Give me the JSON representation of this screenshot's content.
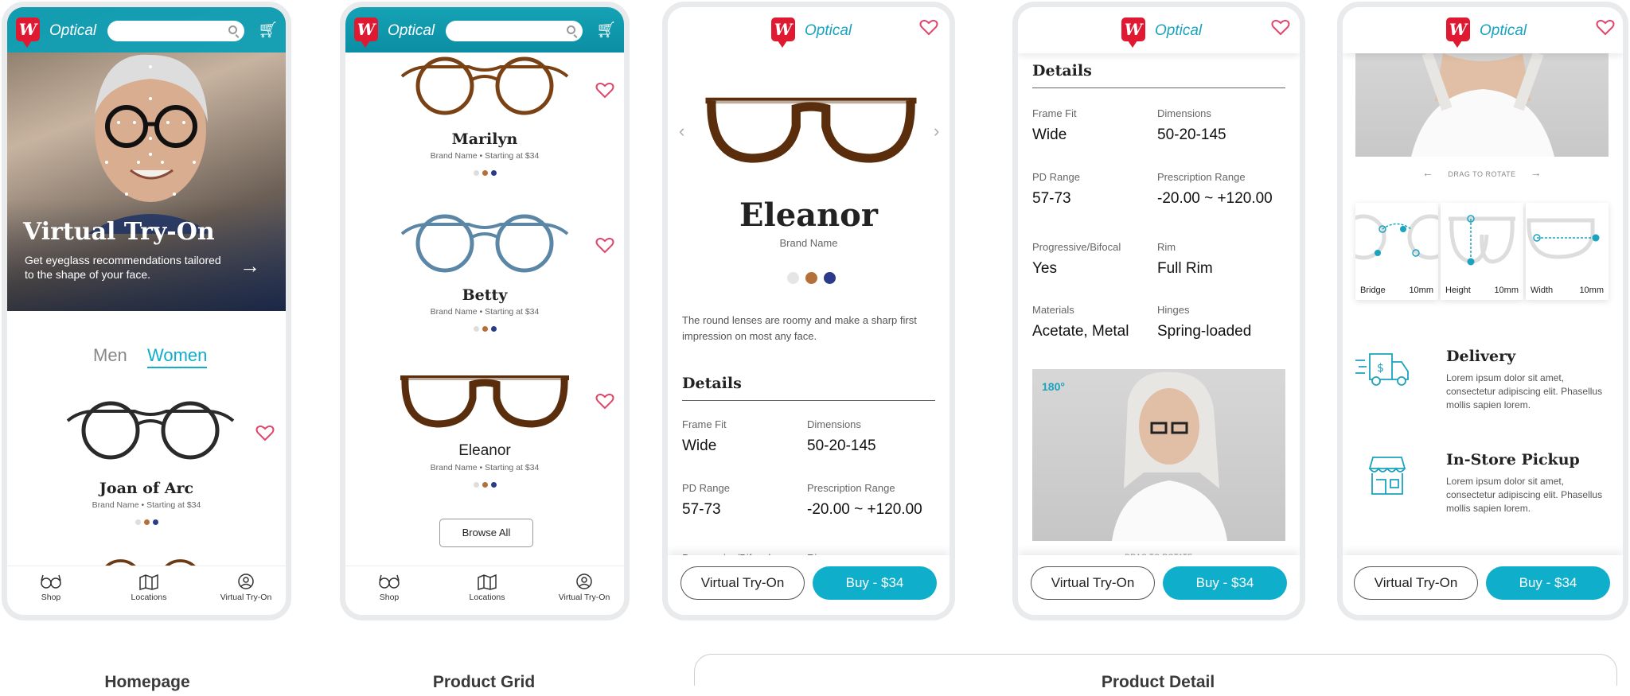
{
  "colors": {
    "teal": "#0e9fb4",
    "accent": "#0faecb",
    "brand_red": "#e01933",
    "heart": "#e0456a"
  },
  "brand": {
    "logo_letter": "W",
    "app_name": "Optical"
  },
  "nav": {
    "shop": "Shop",
    "locations": "Locations",
    "vto": "Virtual Try-On"
  },
  "homepage": {
    "hero_title": "Virtual Try-On",
    "hero_text": "Get eyeglass recommendations tailored to the shape of your face.",
    "tab_men": "Men",
    "tab_women": "Women",
    "product": {
      "name": "Joan of Arc",
      "sub": "Brand Name • Starting at $34"
    }
  },
  "grid": {
    "products": [
      {
        "name": "Marilyn",
        "sub": "Brand Name • Starting at $34"
      },
      {
        "name": "Betty",
        "sub": "Brand Name • Starting at $34"
      },
      {
        "name": "Eleanor",
        "sub": "Brand Name • Starting at $34"
      }
    ],
    "browse_all": "Browse All"
  },
  "detail": {
    "name": "Eleanor",
    "brand": "Brand Name",
    "description": "The round lenses are roomy and make a sharp first impression on most any face.",
    "details_heading": "Details",
    "specs": [
      {
        "label": "Frame Fit",
        "value": "Wide"
      },
      {
        "label": "Dimensions",
        "value": "50-20-145"
      },
      {
        "label": "PD Range",
        "value": "57-73"
      },
      {
        "label": "Prescription Range",
        "value": "-20.00 ~ +120.00"
      },
      {
        "label": "Progressive/Bifocal",
        "value": "Yes"
      },
      {
        "label": "Rim",
        "value": "Full Rim"
      },
      {
        "label": "Materials",
        "value": "Acetate, Metal"
      },
      {
        "label": "Hinges",
        "value": "Spring-loaded"
      }
    ],
    "rotate_badge": "180°",
    "drag_to_rotate": "DRAG TO ROTATE",
    "vto_button": "Virtual Try-On",
    "buy_button": "Buy - $34"
  },
  "measure": [
    {
      "label": "Bridge",
      "value": "10mm"
    },
    {
      "label": "Height",
      "value": "10mm"
    },
    {
      "label": "Width",
      "value": "10mm"
    }
  ],
  "features": [
    {
      "icon": "delivery-truck-icon",
      "title": "Delivery",
      "text": "Lorem ipsum dolor sit amet, consectetur adipiscing elit. Phasellus mollis sapien lorem."
    },
    {
      "icon": "store-icon",
      "title": "In-Store Pickup",
      "text": "Lorem ipsum dolor sit amet, consectetur adipiscing elit. Phasellus mollis sapien lorem."
    }
  ],
  "captions": {
    "homepage": "Homepage",
    "grid": "Product Grid",
    "detail": "Product Detail"
  }
}
